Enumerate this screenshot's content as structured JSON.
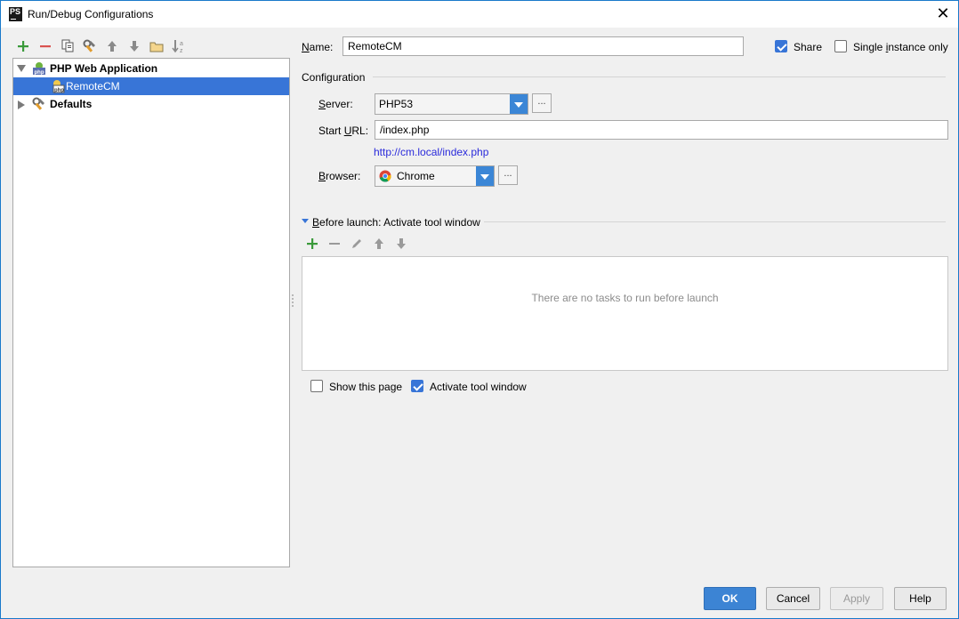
{
  "window": {
    "title": "Run/Debug Configurations",
    "app_icon_text": "PS"
  },
  "toolbar": {
    "items": [
      "add-icon",
      "remove-icon",
      "copy-icon",
      "edit-defaults-icon",
      "move-up-icon",
      "move-down-icon",
      "folder-icon",
      "sort-icon"
    ]
  },
  "tree": {
    "group_label": "PHP Web Application",
    "item_label": "RemoteCM",
    "defaults_label": "Defaults"
  },
  "form": {
    "name_label_u": "N",
    "name_label_rest": "ame:",
    "name_value": "RemoteCM",
    "share_label": "Share",
    "share_checked": true,
    "single_instance_label_pre": "Single ",
    "single_instance_label_u": "i",
    "single_instance_label_rest": "nstance only",
    "single_instance_checked": false,
    "configuration_heading": "Configuration",
    "server_label_u": "S",
    "server_label_rest": "erver:",
    "server_value": "PHP53",
    "start_url_label_pre": "Start ",
    "start_url_label_u": "U",
    "start_url_label_rest": "RL:",
    "start_url_value": "/index.php",
    "resolved_url": "http://cm.local/index.php",
    "browser_label_u": "B",
    "browser_label_rest": "rowser:",
    "browser_value": "Chrome",
    "dots": "..."
  },
  "before_launch": {
    "heading_u": "B",
    "heading_rest": "efore launch: Activate tool window",
    "empty_text": "There are no tasks to run before launch",
    "show_page_label": "Show this page",
    "show_page_checked": false,
    "activate_label": "Activate tool window",
    "activate_checked": true
  },
  "buttons": {
    "ok": "OK",
    "cancel": "Cancel",
    "apply": "Apply",
    "help": "Help"
  },
  "colors": {
    "accent": "#3875d7",
    "add_green": "#3a9a3a",
    "remove_red": "#d9534f",
    "link": "#2a2adb"
  }
}
